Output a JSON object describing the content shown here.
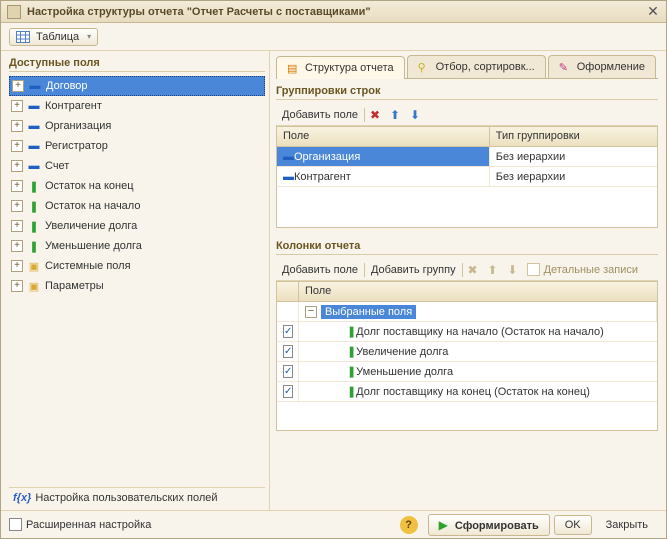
{
  "titlebar": {
    "title": "Настройка структуры отчета \"Отчет  Расчеты с поставщиками\""
  },
  "toolbar": {
    "table_btn": "Таблица"
  },
  "left": {
    "title": "Доступные поля",
    "fields": [
      {
        "label": "Договор",
        "icon": "blue",
        "selected": true
      },
      {
        "label": "Контрагент",
        "icon": "blue"
      },
      {
        "label": "Организация",
        "icon": "blue"
      },
      {
        "label": "Регистратор",
        "icon": "blue"
      },
      {
        "label": "Счет",
        "icon": "blue"
      },
      {
        "label": "Остаток на конец",
        "icon": "green"
      },
      {
        "label": "Остаток на начало",
        "icon": "green"
      },
      {
        "label": "Увеличение долга",
        "icon": "green"
      },
      {
        "label": "Уменьшение долга",
        "icon": "green"
      },
      {
        "label": "Системные поля",
        "icon": "folder"
      },
      {
        "label": "Параметры",
        "icon": "folder"
      }
    ],
    "user_fields": "Настройка пользовательских полей"
  },
  "tabs": {
    "structure": "Структура отчета",
    "filter": "Отбор, сортировк...",
    "design": "Оформление"
  },
  "groupings": {
    "title": "Группировки строк",
    "add_field": "Добавить поле",
    "columns": {
      "field": "Поле",
      "type": "Тип группировки"
    },
    "rows": [
      {
        "field": "Организация",
        "type": "Без иерархии",
        "selected": true
      },
      {
        "field": "Контрагент",
        "type": "Без иерархии"
      }
    ]
  },
  "columns": {
    "title": "Колонки отчета",
    "add_field": "Добавить поле",
    "add_group": "Добавить группу",
    "detail": "Детальные записи",
    "header": "Поле",
    "root": "Выбранные поля",
    "rows": [
      {
        "label": "Долг поставщику на начало (Остаток на начало)",
        "checked": true
      },
      {
        "label": "Увеличение долга",
        "checked": true
      },
      {
        "label": "Уменьшение долга",
        "checked": true
      },
      {
        "label": "Долг поставщику на конец (Остаток на конец)",
        "checked": true
      }
    ]
  },
  "footer": {
    "extended": "Расширенная настройка",
    "form": "Сформировать",
    "ok": "OK",
    "close": "Закрыть"
  }
}
